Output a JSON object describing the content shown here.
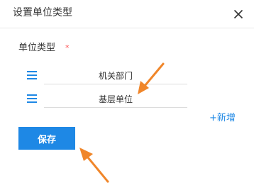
{
  "dialog": {
    "title": "设置单位类型",
    "close_icon": "close-icon"
  },
  "form": {
    "field_label": "单位类型",
    "required_mark": "*",
    "items": [
      {
        "value": "机关部门",
        "handle_icon": "drag-handle-icon"
      },
      {
        "value": "基层单位",
        "handle_icon": "drag-handle-icon"
      }
    ],
    "add_label": "+新增"
  },
  "actions": {
    "save_label": "保存"
  },
  "colors": {
    "accent": "#1e88e5",
    "required": "#ff4d4f",
    "annotation_arrow": "#f0862a"
  }
}
